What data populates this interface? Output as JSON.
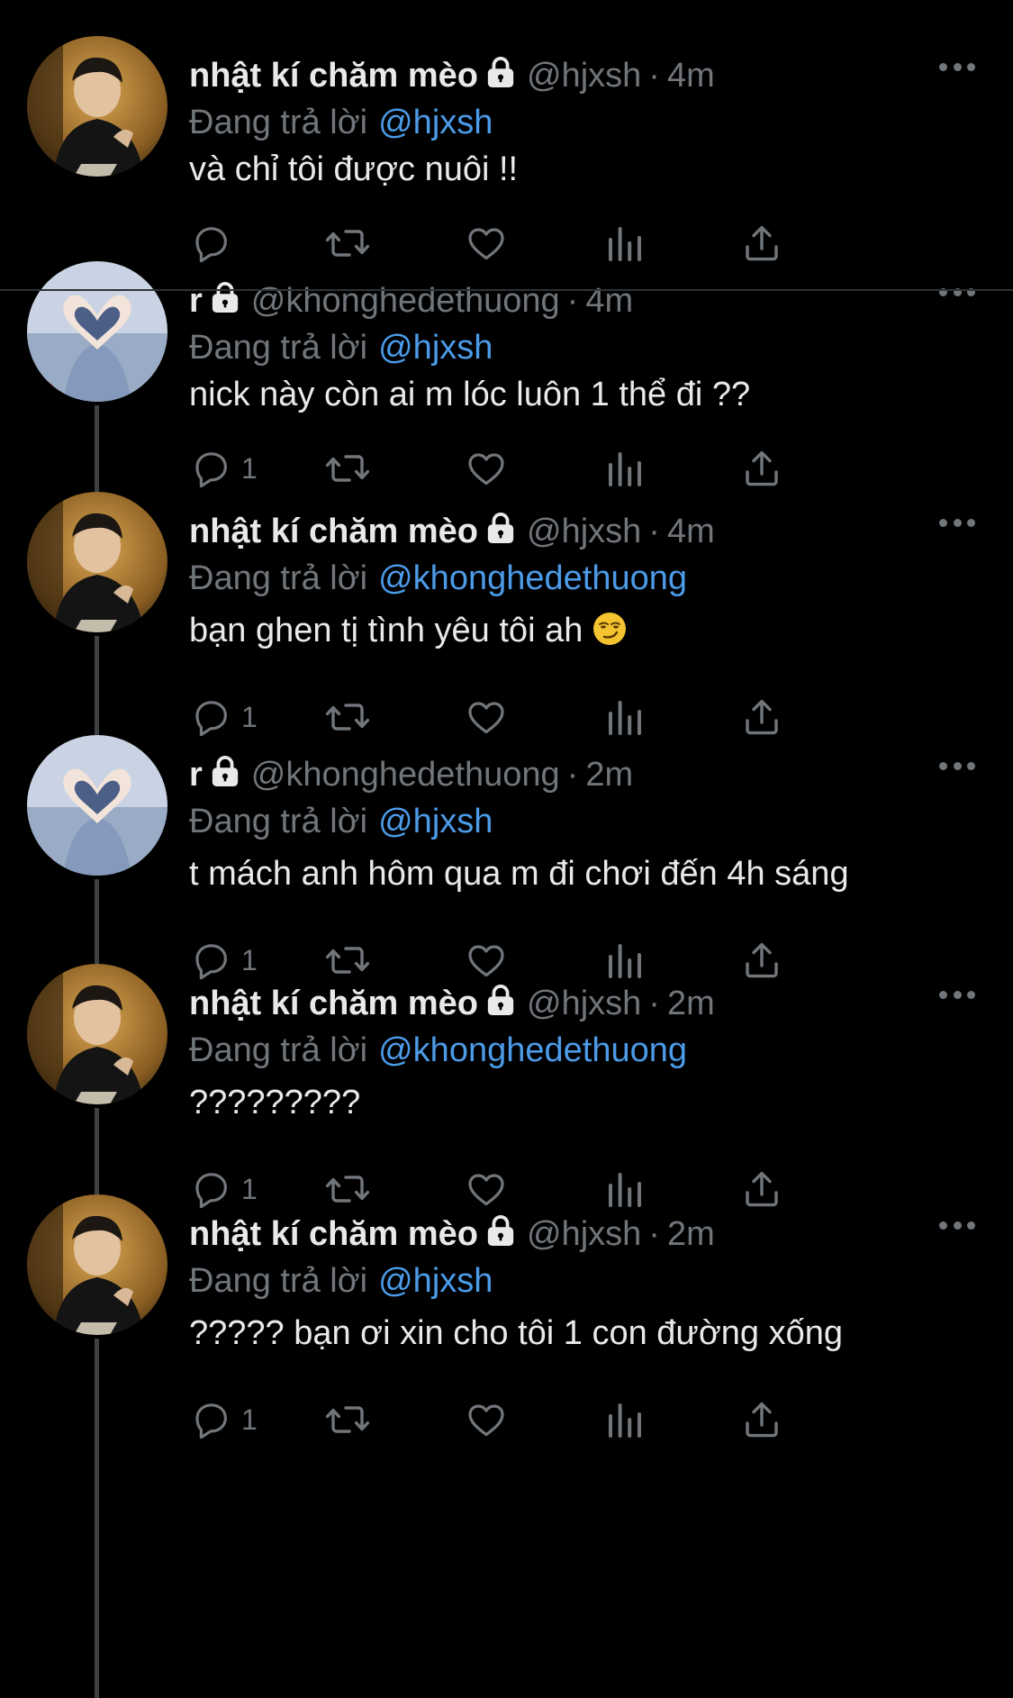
{
  "theme": {
    "background": "#000000",
    "text": "#e7e9ea",
    "muted": "#71767b",
    "link": "#4c9be8",
    "thread_line": "#3e4144"
  },
  "tweets": [
    {
      "display_name": "nhật kí chăm mèo",
      "handle": "@hjxsh",
      "sep": "·",
      "time": "4m",
      "reply_prefix": "Đang trả lời",
      "reply_to": "@hjxsh",
      "text": "và chỉ tôi được nuôi !!",
      "reply_count": "",
      "avatar": "boy-in-dark-jacket"
    },
    {
      "display_name": "r",
      "handle": "@khonghedethuong",
      "sep": "·",
      "time": "4m",
      "reply_prefix": "Đang trả lời",
      "reply_to": "@hjxsh",
      "text": "nick này còn ai m lóc luôn 1 thể đi ??",
      "reply_count": "1",
      "avatar": "hands-heart"
    },
    {
      "display_name": "nhật kí chăm mèo",
      "handle": "@hjxsh",
      "sep": "·",
      "time": "4m",
      "reply_prefix": "Đang trả lời",
      "reply_to": "@khonghedethuong",
      "text": "bạn ghen tị tình yêu tôi ah",
      "emoji": "smirk-face",
      "reply_count": "1",
      "avatar": "boy-in-dark-jacket"
    },
    {
      "display_name": "r",
      "handle": "@khonghedethuong",
      "sep": "·",
      "time": "2m",
      "reply_prefix": "Đang trả lời",
      "reply_to": "@hjxsh",
      "text": "t mách anh hôm qua m đi chơi đến 4h sáng",
      "reply_count": "1",
      "avatar": "hands-heart"
    },
    {
      "display_name": "nhật kí chăm mèo",
      "handle": "@hjxsh",
      "sep": "·",
      "time": "2m",
      "reply_prefix": "Đang trả lời",
      "reply_to": "@khonghedethuong",
      "text": "?????????",
      "reply_count": "1",
      "avatar": "boy-in-dark-jacket"
    },
    {
      "display_name": "nhật kí chăm mèo",
      "handle": "@hjxsh",
      "sep": "·",
      "time": "2m",
      "reply_prefix": "Đang trả lời",
      "reply_to": "@hjxsh",
      "text": "????? bạn ơi xin cho tôi 1 con đường xống",
      "reply_count": "1",
      "avatar": "boy-in-dark-jacket"
    }
  ]
}
